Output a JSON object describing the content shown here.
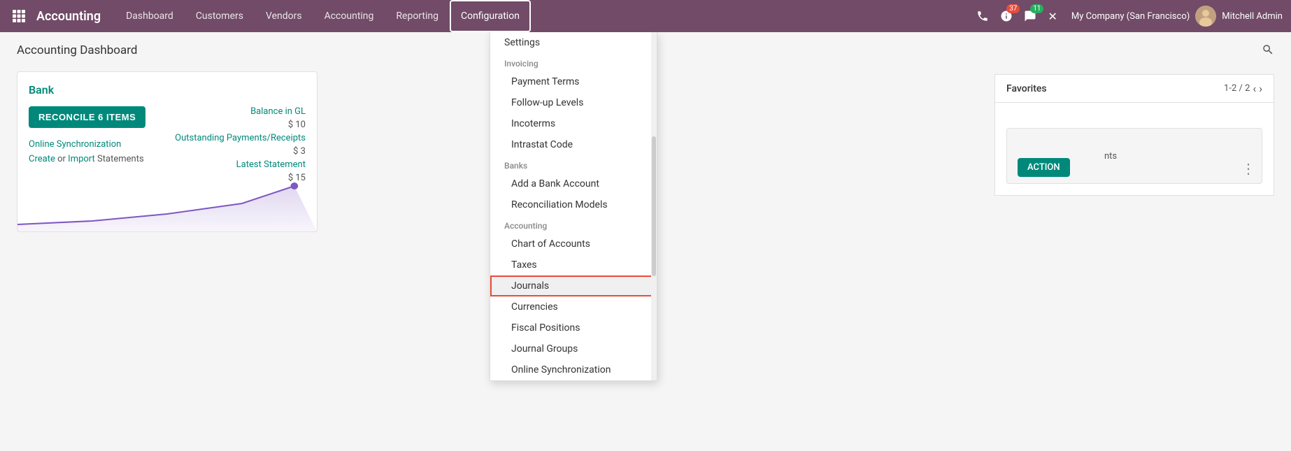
{
  "app": {
    "brand": "Accounting",
    "page_title": "Accounting Dashboard"
  },
  "navbar": {
    "menu_items": [
      {
        "label": "Dashboard",
        "active": false
      },
      {
        "label": "Customers",
        "active": false
      },
      {
        "label": "Vendors",
        "active": false
      },
      {
        "label": "Accounting",
        "active": false
      },
      {
        "label": "Reporting",
        "active": false
      },
      {
        "label": "Configuration",
        "active": true
      }
    ],
    "icons": {
      "phone": "📞",
      "activity_count": "37",
      "message_count": "11",
      "close": "✕"
    },
    "company": "My Company (San Francisco)",
    "user": "Mitchell Admin"
  },
  "bank_card": {
    "title": "Bank",
    "reconcile_btn": "RECONCILE 6 ITEMS",
    "online_sync": "Online Synchronization",
    "create_label": "Create",
    "or_label": "or",
    "import_label": "Import",
    "statements_label": "Statements",
    "balance_label": "Balance in GL",
    "balance_amount": "$ 10",
    "outstanding_label": "Outstanding Payments/Receipts",
    "outstanding_amount": "$ 3",
    "statement_label": "Latest Statement",
    "statement_amount": "$ 15"
  },
  "favorites": {
    "title": "Favorites",
    "pagination": "1-2 / 2"
  },
  "dropdown": {
    "settings_item": "Settings",
    "sections": [
      {
        "label": "Invoicing",
        "items": [
          "Payment Terms",
          "Follow-up Levels",
          "Incoterms",
          "Intrastat Code"
        ]
      },
      {
        "label": "Banks",
        "items": [
          "Add a Bank Account",
          "Reconciliation Models"
        ]
      },
      {
        "label": "Accounting",
        "items": [
          "Chart of Accounts",
          "Taxes",
          "Journals",
          "Currencies",
          "Fiscal Positions",
          "Journal Groups",
          "Online Synchronization"
        ]
      }
    ],
    "highlighted_item": "Journals"
  },
  "colors": {
    "teal": "#00897b",
    "purple": "#714B67",
    "highlighted_border": "#e74c3c"
  }
}
